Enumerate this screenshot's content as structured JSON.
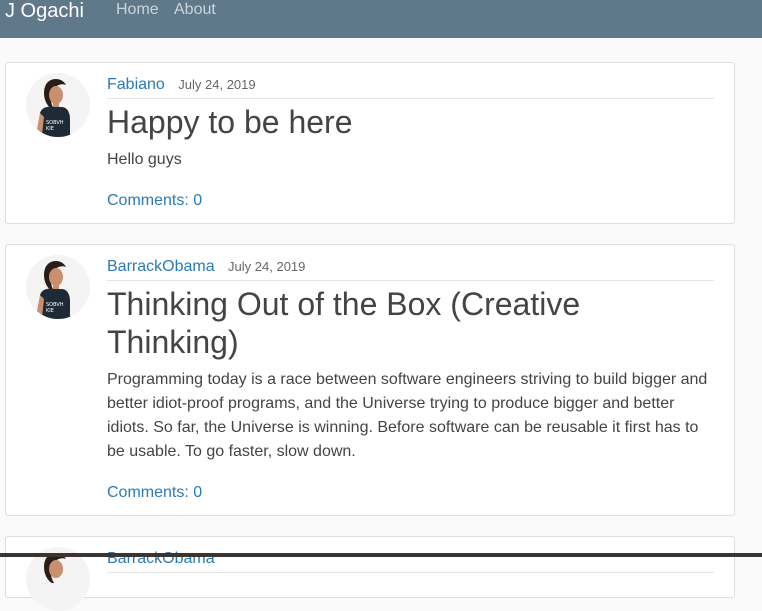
{
  "navbar": {
    "brand": "J Ogachi",
    "links": [
      "Home",
      "About"
    ]
  },
  "posts": [
    {
      "author": "Fabiano",
      "date": "July 24, 2019",
      "title": "Happy to be here",
      "content": "Hello guys",
      "comments_label": "Comments: 0"
    },
    {
      "author": "BarrackObama",
      "date": "July 24, 2019",
      "title": "Thinking Out of the Box (Creative Thinking)",
      "content": "Programming today is a race between software engineers striving to build bigger and better idiot-proof programs, and the Universe trying to produce bigger and better idiots. So far, the Universe is winning. Before software can be reusable it first has to be usable. To go faster, slow down.",
      "comments_label": "Comments: 0"
    },
    {
      "author": "BarrackObama"
    }
  ],
  "colors": {
    "navbar": "#5f788a",
    "link": "#2a7ab5"
  }
}
